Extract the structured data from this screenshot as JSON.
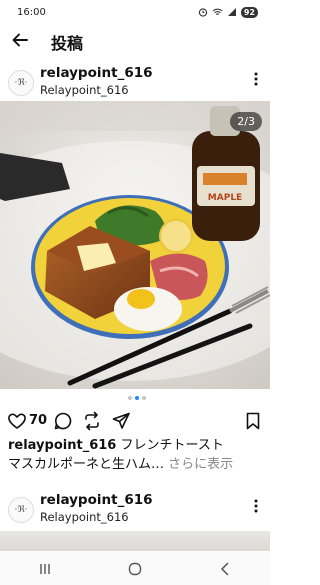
{
  "status_bar": {
    "time": "16:00",
    "battery": "92",
    "icons": [
      "alarm-icon",
      "wifi-icon",
      "signal-icon",
      "battery-icon"
    ]
  },
  "header": {
    "title": "投稿",
    "back_icon": "arrow-left-icon"
  },
  "post": {
    "username": "relaypoint_616",
    "subtitle": "Relaypoint_616",
    "avatar_text": "·ℜ·",
    "image_counter": "2/3",
    "likes": "70",
    "caption_user": "relaypoint_616",
    "caption_text": "フレンチトースト",
    "caption_line2": "マスカルポーネと生ハム…",
    "see_more": "さらに表示",
    "action_icons": [
      "heart-icon",
      "comment-icon",
      "repost-icon",
      "share-icon",
      "bookmark-icon"
    ],
    "photo_scene": {
      "bottle_label": "MAPLE"
    }
  },
  "next_post": {
    "username": "relaypoint_616",
    "subtitle": "Relaypoint_616",
    "avatar_text": "·ℜ·"
  },
  "colors": {
    "accent_dot": "#1d8cf8",
    "plate": "#f2d23a",
    "plate_rim": "#3e6fb8"
  },
  "nav": [
    "recent-apps-icon",
    "home-icon",
    "back-icon"
  ]
}
